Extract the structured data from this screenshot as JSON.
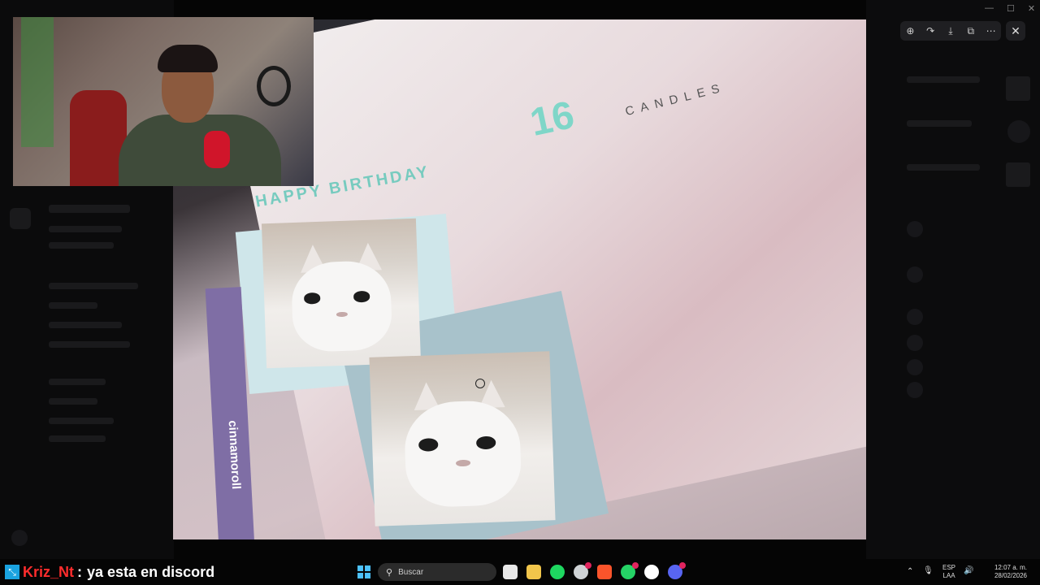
{
  "app": {
    "window_title": ""
  },
  "viewer_toolbar": {
    "icons": [
      "zoom-in-icon",
      "forward-icon",
      "download-icon",
      "open-external-icon",
      "more-icon"
    ],
    "close_glyph": "✕"
  },
  "photo": {
    "title_number": "16",
    "title_word": "CANDLES",
    "banner": "HAPPY BIRTHDAY",
    "ruler_label": "cinnamoroll"
  },
  "chat_overlay": {
    "username": "Kriz_Nt",
    "separator": ":",
    "message": "ya esta en discord",
    "username_color": "#ff2d2d"
  },
  "taskbar": {
    "search_placeholder": "Buscar",
    "language_top": "ESP",
    "language_bottom": "LAA",
    "time": "12:07 a. m.",
    "date": "28/02/2026"
  }
}
